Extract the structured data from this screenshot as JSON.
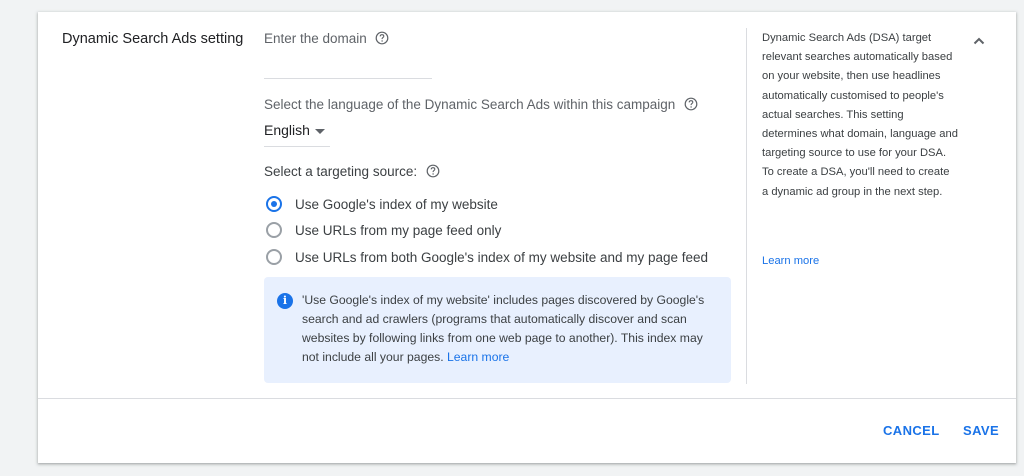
{
  "section": {
    "title": "Dynamic Search Ads setting"
  },
  "domain": {
    "label": "Enter the domain",
    "value": ""
  },
  "language": {
    "label": "Select the language of the Dynamic Search Ads within this campaign",
    "selected": "English"
  },
  "targeting": {
    "label": "Select a targeting source:",
    "options": [
      {
        "label": "Use Google's index of my website",
        "checked": true
      },
      {
        "label": "Use URLs from my page feed only",
        "checked": false
      },
      {
        "label": "Use URLs from both Google's index of my website and my page feed",
        "checked": false
      }
    ]
  },
  "info": {
    "text": "'Use Google's index of my website' includes pages discovered by Google's search and ad crawlers (programs that automatically discover and scan websites by following links from one web page to another). This index may not include all your pages.",
    "link": "Learn more"
  },
  "sidebar": {
    "text": "Dynamic Search Ads (DSA) target relevant searches automatically based on your website, then use headlines automatically customised to people's actual searches. This setting determines what domain, language and targeting source to use for your DSA. To create a DSA, you'll need to create a dynamic ad group in the next step.",
    "link": "Learn more"
  },
  "actions": {
    "cancel": "CANCEL",
    "save": "SAVE"
  },
  "icons": {
    "help": "help-circle-icon",
    "info": "info-icon",
    "collapse": "chevron-up-icon",
    "dropdown": "caret-down-icon"
  },
  "colors": {
    "accent": "#1a73e8",
    "info_bg": "#e8f0fe",
    "divider": "#dadce0"
  }
}
